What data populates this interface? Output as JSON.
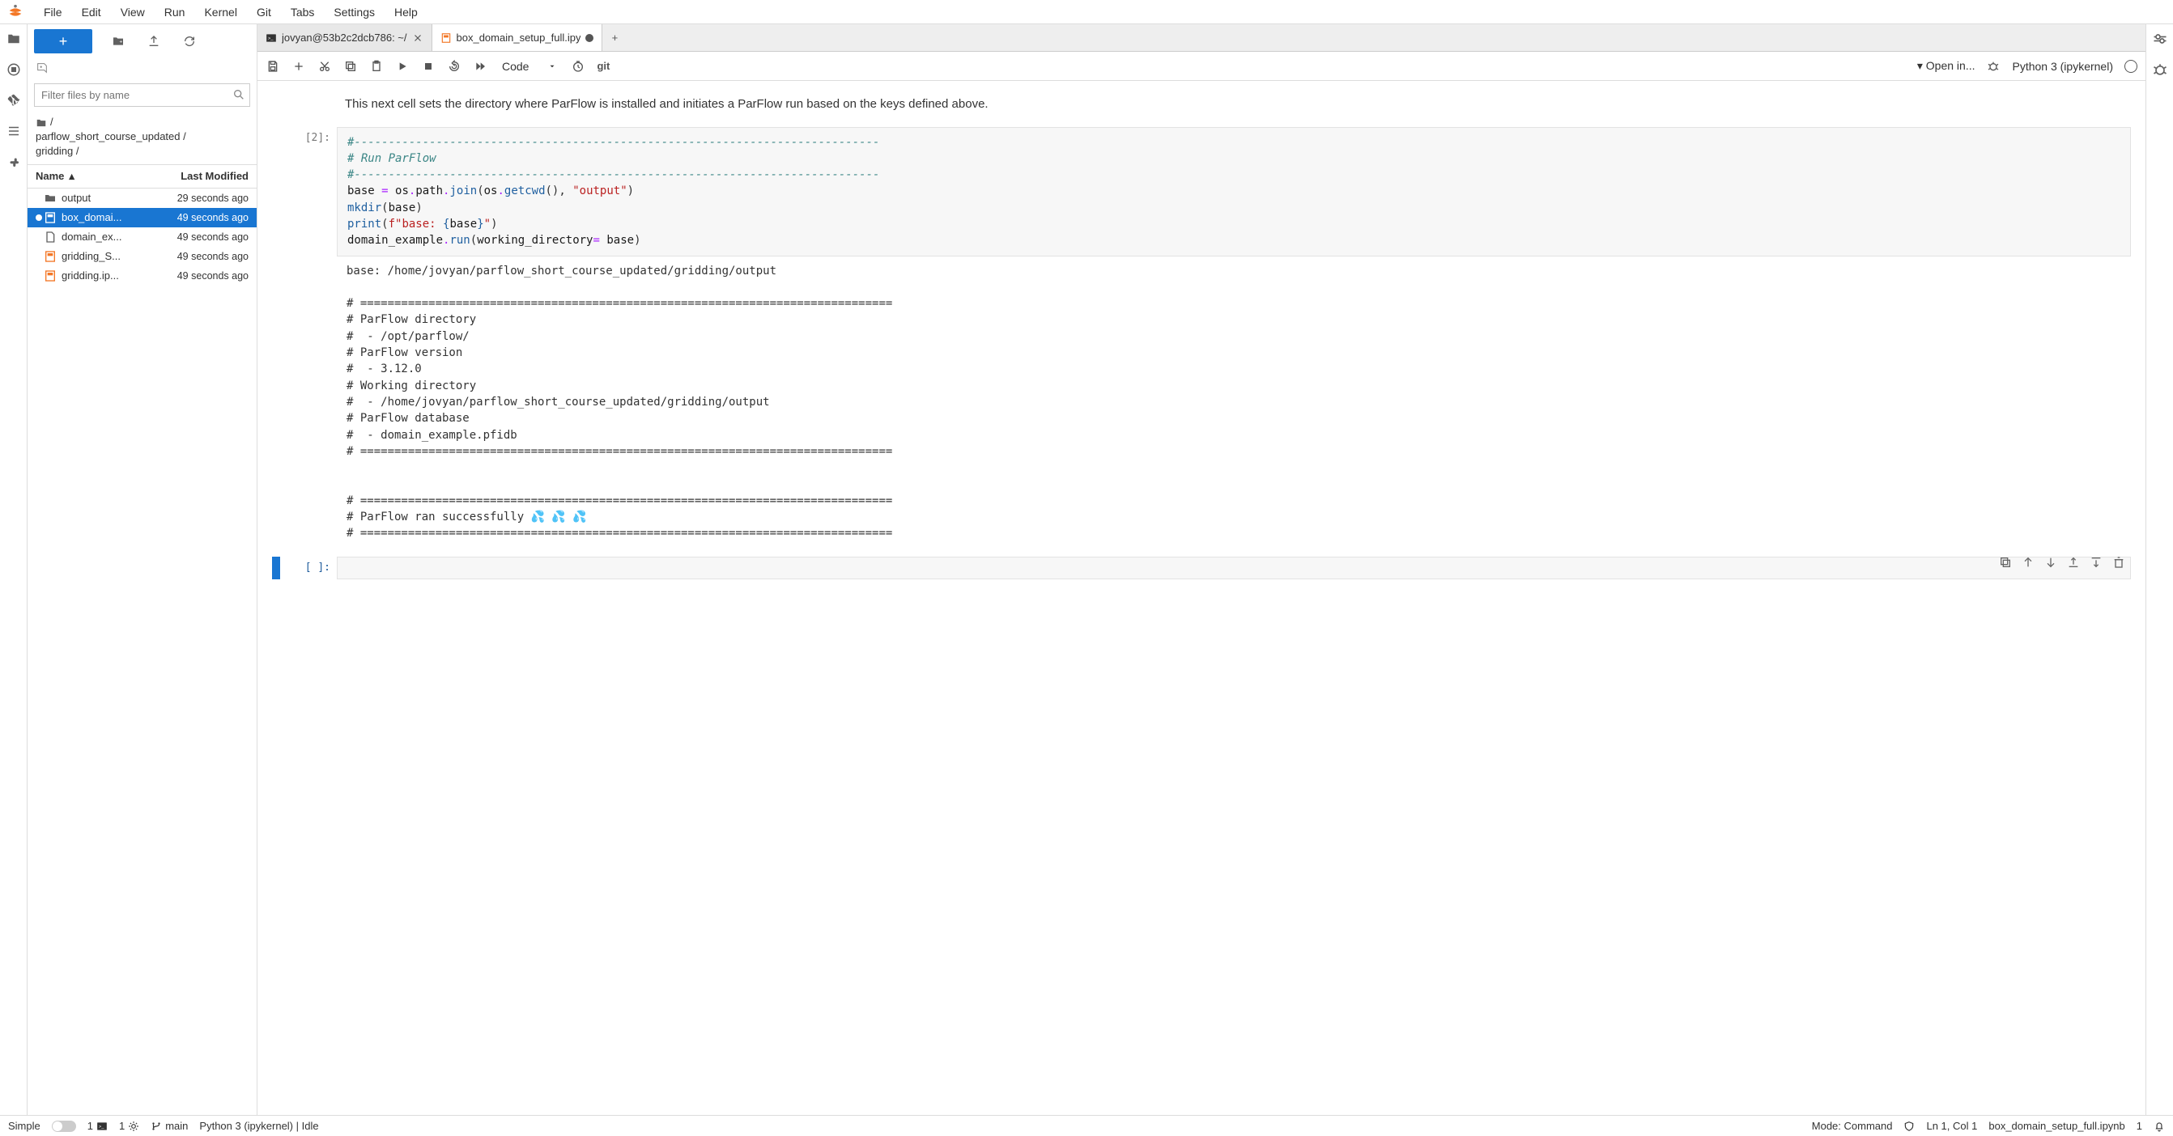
{
  "menu": {
    "items": [
      "File",
      "Edit",
      "View",
      "Run",
      "Kernel",
      "Git",
      "Tabs",
      "Settings",
      "Help"
    ]
  },
  "filepanel": {
    "filter_placeholder": "Filter files by name",
    "breadcrumb_line1": "/",
    "breadcrumb_line2": "parflow_short_course_updated /",
    "breadcrumb_line3": "gridding /",
    "col_name": "Name",
    "col_mod": "Last Modified",
    "sort_asc": "▴",
    "files": [
      {
        "type": "folder",
        "name": "output",
        "mod": "29 seconds ago",
        "selected": false,
        "icon": "folder"
      },
      {
        "type": "notebook",
        "name": "box_domai...",
        "mod": "49 seconds ago",
        "selected": true,
        "icon": "nb",
        "dirty": true
      },
      {
        "type": "file",
        "name": "domain_ex...",
        "mod": "49 seconds ago",
        "selected": false,
        "icon": "file"
      },
      {
        "type": "notebook",
        "name": "gridding_S...",
        "mod": "49 seconds ago",
        "selected": false,
        "icon": "nb"
      },
      {
        "type": "notebook",
        "name": "gridding.ip...",
        "mod": "49 seconds ago",
        "selected": false,
        "icon": "nb"
      }
    ]
  },
  "tabs": [
    {
      "label": "jovyan@53b2c2dcb786: ~/",
      "icon": "terminal",
      "active": false,
      "dirty": false,
      "closable": true
    },
    {
      "label": "box_domain_setup_full.ipy",
      "icon": "nb",
      "active": true,
      "dirty": true,
      "closable": false
    }
  ],
  "nb_toolbar": {
    "celltype": "Code",
    "openin": "Open in...",
    "git_label": "git",
    "kernel": "Python 3 (ipykernel)"
  },
  "cells": {
    "markdown": "This next cell sets the directory where ParFlow is installed and initiates a ParFlow run based on the keys defined above.",
    "c1_prompt": "[2]:",
    "c1_code_line1": "#-----------------------------------------------------------------------------",
    "c1_code_line2": "# Run ParFlow",
    "c1_code_line3": "#-----------------------------------------------------------------------------",
    "c1_base1": "base ",
    "c1_eq": "= ",
    "c1_os": "os",
    "c1_dot": ".",
    "c1_path": "path",
    "c1_join": "join",
    "c1_getcwd": "getcwd",
    "c1_outstr": "\"output\"",
    "c1_mkdir": "mkdir",
    "c1_print": "print",
    "c1_fstr_pre": "f\"base: ",
    "c1_fstr_open": "{",
    "c1_fstr_var": "base",
    "c1_fstr_close": "}",
    "c1_fstr_end": "\"",
    "c1_domex": "domain_example",
    "c1_run": "run",
    "c1_wd": "working_directory",
    "c1_base_id": "base",
    "c1_output": "base: /home/jovyan/parflow_short_course_updated/gridding/output\n\n# ==============================================================================\n# ParFlow directory\n#  - /opt/parflow/\n# ParFlow version\n#  - 3.12.0\n# Working directory\n#  - /home/jovyan/parflow_short_course_updated/gridding/output\n# ParFlow database\n#  - domain_example.pfidb\n# ==============================================================================\n\n\n# ==============================================================================\n# ParFlow ran successfully 💦 💦 💦\n# ==============================================================================",
    "c2_prompt": "[ ]:"
  },
  "statusbar": {
    "simple": "Simple",
    "term_count": "1",
    "kernel_count": "1",
    "branch": "main",
    "kernel_status": "Python 3 (ipykernel) | Idle",
    "mode": "Mode: Command",
    "ln": "Ln 1, Col 1",
    "filename": "box_domain_setup_full.ipynb",
    "notif": "1"
  }
}
